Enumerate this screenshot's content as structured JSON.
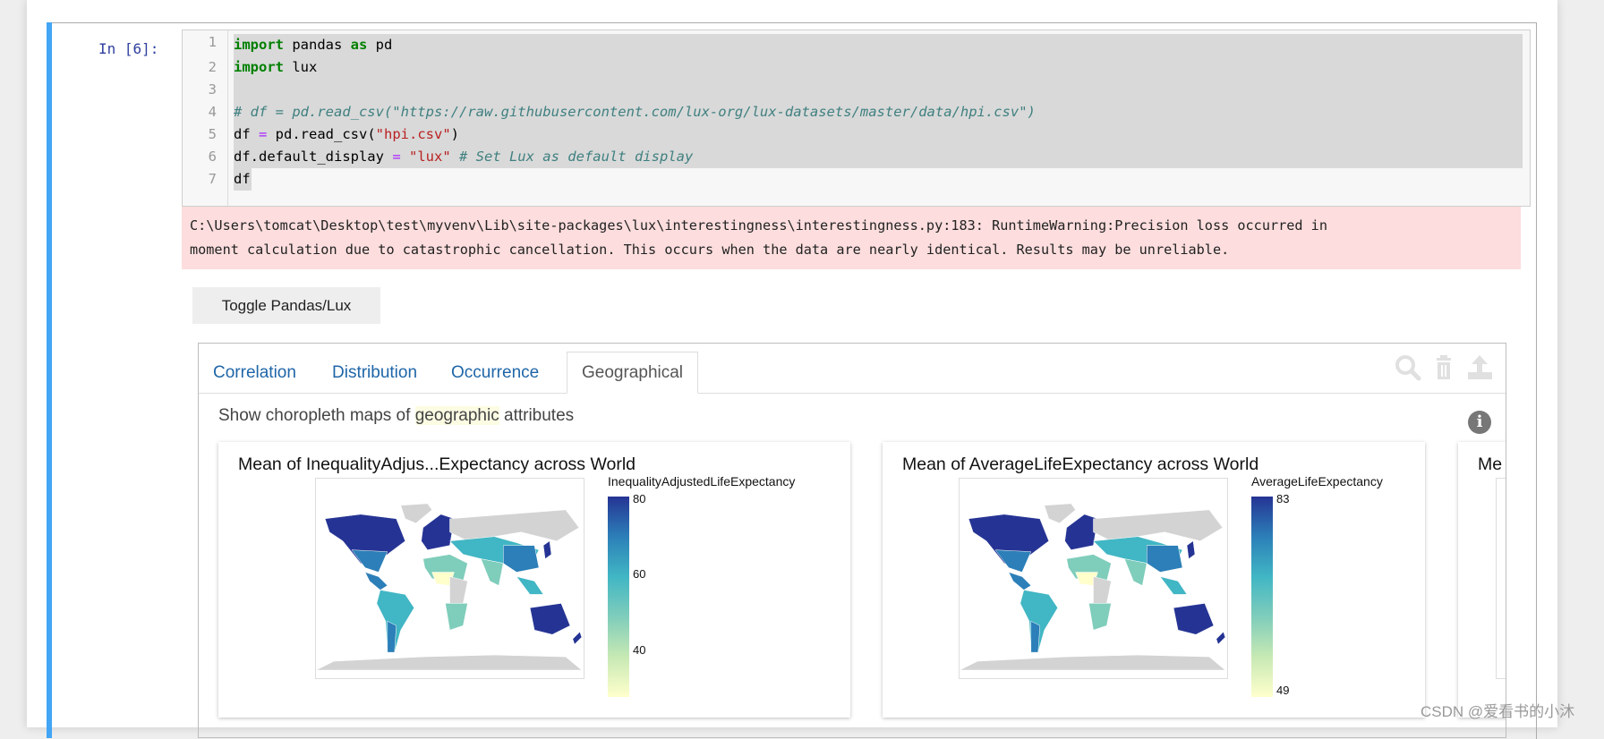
{
  "cell": {
    "prompt": "In  [6]:",
    "lines": [
      "1",
      "2",
      "3",
      "4",
      "5",
      "6",
      "7"
    ],
    "code": {
      "l1_kw1": "import",
      "l1_a": " pandas ",
      "l1_kw2": "as",
      "l1_b": " pd",
      "l2_kw": "import",
      "l2_a": " lux",
      "l4_cm": "# df = pd.read_csv(\"https://raw.githubusercontent.com/lux-org/lux-datasets/master/data/hpi.csv\")",
      "l5_a": "df ",
      "l5_op": "=",
      "l5_b": " pd.read_csv(",
      "l5_st": "\"hpi.csv\"",
      "l5_c": ")",
      "l6_a": "df.default_display ",
      "l6_op": "=",
      "l6_st": " \"lux\"",
      "l6_cm": " # Set Lux as default display",
      "l7": "df"
    }
  },
  "warning": {
    "line1": "C:\\Users\\tomcat\\Desktop\\test\\myvenv\\Lib\\site-packages\\lux\\interestingness\\interestingness.py:183: RuntimeWarning:Precision loss occurred in",
    "line2": "moment calculation due to catastrophic cancellation. This occurs when the data are nearly identical. Results may be unreliable."
  },
  "toggle_label": "Toggle Pandas/Lux",
  "widget": {
    "tabs": [
      {
        "label": "Correlation"
      },
      {
        "label": "Distribution"
      },
      {
        "label": "Occurrence"
      },
      {
        "label": "Geographical",
        "active": true
      }
    ],
    "toolbar_icons": [
      "search-icon",
      "trash-icon",
      "export-icon"
    ],
    "desc_pre": "Show choropleth maps of ",
    "desc_hl": "geographic",
    "desc_post": " attributes",
    "info_icon": "i",
    "charts": [
      {
        "title": "Mean of InequalityAdjus...Expectancy across World",
        "legend_title": "InequalityAdjustedLifeExpectancy",
        "ticks": [
          "80",
          "60",
          "40"
        ]
      },
      {
        "title": "Mean of AverageLifeExpectancy across World",
        "legend_title": "AverageLifeExpectancy",
        "ticks": [
          "83",
          "49"
        ]
      },
      {
        "title": "Me"
      }
    ],
    "colorscale": [
      "#253494",
      "#2c7fb8",
      "#41b6c4",
      "#7fcdbb",
      "#c7e9b4",
      "#ffffcc"
    ],
    "no_data_color": "#d3d3d3"
  },
  "watermark": "CSDN @爱看书的小沐"
}
